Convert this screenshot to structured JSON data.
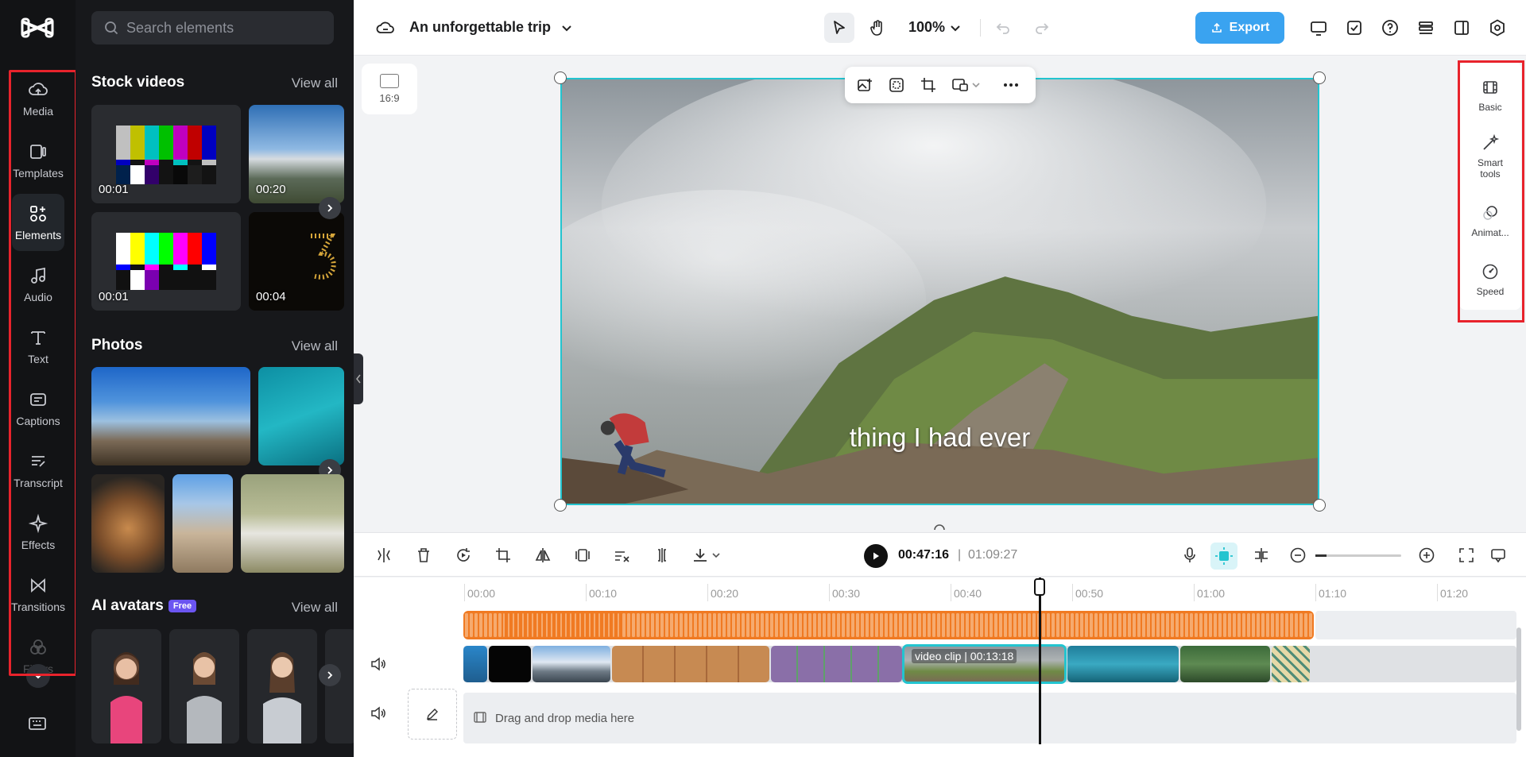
{
  "rail": {
    "items": [
      {
        "label": "Media",
        "icon": "cloud-upload-icon"
      },
      {
        "label": "Templates",
        "icon": "templates-icon"
      },
      {
        "label": "Elements",
        "icon": "elements-icon",
        "active": true
      },
      {
        "label": "Audio",
        "icon": "music-note-icon"
      },
      {
        "label": "Text",
        "icon": "text-icon"
      },
      {
        "label": "Captions",
        "icon": "captions-icon"
      },
      {
        "label": "Transcript",
        "icon": "transcript-icon"
      },
      {
        "label": "Effects",
        "icon": "sparkle-icon"
      },
      {
        "label": "Transitions",
        "icon": "transitions-icon"
      },
      {
        "label": "Filters",
        "icon": "filters-icon"
      }
    ]
  },
  "panel": {
    "search_placeholder": "Search elements",
    "stock_videos": {
      "title": "Stock videos",
      "view_all": "View all",
      "items": [
        {
          "duration": "00:01"
        },
        {
          "duration": "00:20"
        },
        {
          "duration": "00:01"
        },
        {
          "duration": "00:04"
        }
      ]
    },
    "photos": {
      "title": "Photos",
      "view_all": "View all"
    },
    "ai_avatars": {
      "title": "AI avatars",
      "badge": "Free",
      "view_all": "View all"
    }
  },
  "topbar": {
    "project_title": "An unforgettable trip",
    "zoom": "100%",
    "export_label": "Export"
  },
  "canvas": {
    "aspect_ratio": "16:9",
    "caption": "thing I had ever"
  },
  "properties": {
    "items": [
      {
        "label": "Basic",
        "icon": "film-icon"
      },
      {
        "label": "Smart tools",
        "icon": "magic-wand-icon"
      },
      {
        "label": "Animat...",
        "icon": "animation-icon"
      },
      {
        "label": "Speed",
        "icon": "speed-icon"
      }
    ]
  },
  "playback": {
    "current_time": "00:47:16",
    "separator": "|",
    "total_time": "01:09:27"
  },
  "timeline": {
    "ticks": [
      "00:00",
      "00:10",
      "00:20",
      "00:30",
      "00:40",
      "00:50",
      "01:00",
      "01:10",
      "01:20"
    ],
    "selected_clip_label": "video clip | 00:13:18",
    "drop_hint": "Drag and drop media here"
  },
  "colors": {
    "accent": "#23c4cf",
    "export": "#3aa3f0",
    "audio_track": "#f07a22",
    "highlight_box": "#e8232c"
  }
}
